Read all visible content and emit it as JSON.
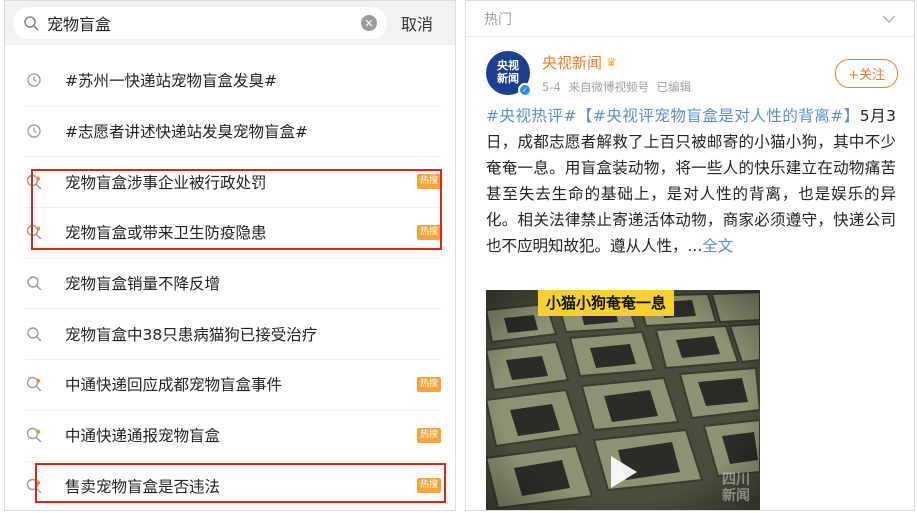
{
  "search": {
    "value": "宠物盲盒",
    "cancel_label": "取消"
  },
  "suggestions": [
    {
      "label": "#苏州一快递站宠物盲盒发臭#",
      "icon": "clock-icon",
      "hot": false
    },
    {
      "label": "#志愿者讲述快递站发臭宠物盲盒#",
      "icon": "clock-icon",
      "hot": false
    },
    {
      "label": "宠物盲盒涉事企业被行政处罚",
      "icon": "hot-search-icon",
      "hot": true
    },
    {
      "label": "宠物盲盒或带来卫生防疫隐患",
      "icon": "hot-search-icon",
      "hot": true
    },
    {
      "label": "宠物盲盒销量不降反增",
      "icon": "search-icon",
      "hot": false
    },
    {
      "label": "宠物盲盒中38只患病猫狗已接受治疗",
      "icon": "search-icon",
      "hot": false
    },
    {
      "label": "中通快递回应成都宠物盲盒事件",
      "icon": "hot-search-icon",
      "hot": true
    },
    {
      "label": "中通快递通报宠物盲盒",
      "icon": "hot-search-icon",
      "hot": true
    },
    {
      "label": "售卖宠物盲盒是否违法",
      "icon": "hot-search-icon",
      "hot": true
    }
  ],
  "hot_badge_label": "热搜",
  "right": {
    "section_title": "热门",
    "avatar_line1": "央视",
    "avatar_line2": "新闻",
    "author": "央视新闻",
    "date": "5-4",
    "source": "来自微博视频号",
    "edited": "已编辑",
    "follow_label": "+关注",
    "tag1": "#央视热评#",
    "tag2": "【#央视评宠物盲盒是对人性的背离#】",
    "body": "5月3日，成都志愿者解救了上百只被邮寄的小猫小狗，其中不少奄奄一息。用盲盒装动物，将一些人的快乐建立在动物痛苦甚至失去生命的基础上，是对人性的背离，也是娱乐的异化。相关法律禁止寄递活体动物，商家必须遵守，快递公司也不应明知故犯。遵从人性，...",
    "full_text_link": "全文",
    "video_caption": "小猫小狗奄奄一息",
    "watermark_line1": "四川",
    "watermark_line2": "新闻"
  },
  "colors": {
    "highlight_box": "#e2231a",
    "hot_badge": "#f6a33a",
    "link_blue": "#5a8fc9",
    "author_orange": "#f07a27"
  }
}
